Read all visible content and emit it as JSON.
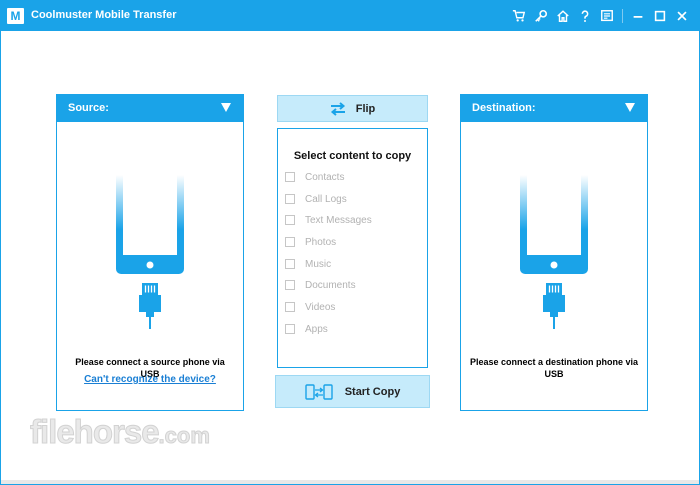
{
  "app": {
    "logo_text": "M",
    "title": "Coolmuster Mobile Transfer",
    "toolbar_icons": [
      "cart-icon",
      "key-icon",
      "home-icon",
      "help-icon",
      "feedback-icon",
      "minimize-icon",
      "maximize-icon",
      "close-icon"
    ]
  },
  "source": {
    "header": "Source:",
    "message": "Please connect a source phone via USB",
    "help_link": "Can't recognize the device?"
  },
  "destination": {
    "header": "Destination:",
    "message": "Please connect a destination phone via USB"
  },
  "center": {
    "flip_label": "Flip",
    "select_title": "Select content to copy",
    "items": [
      {
        "label": "Contacts",
        "checked": false
      },
      {
        "label": "Call Logs",
        "checked": false
      },
      {
        "label": "Text Messages",
        "checked": false
      },
      {
        "label": "Photos",
        "checked": false
      },
      {
        "label": "Music",
        "checked": false
      },
      {
        "label": "Documents",
        "checked": false
      },
      {
        "label": "Videos",
        "checked": false
      },
      {
        "label": "Apps",
        "checked": false
      }
    ],
    "start_copy_label": "Start Copy"
  },
  "watermark": {
    "text": "filehorse",
    "suffix": ".com"
  },
  "colors": {
    "accent": "#1aa3e8",
    "button_bg": "#c6ebfb",
    "disabled_text": "#b2b2b2",
    "link": "#1a7fd4"
  }
}
